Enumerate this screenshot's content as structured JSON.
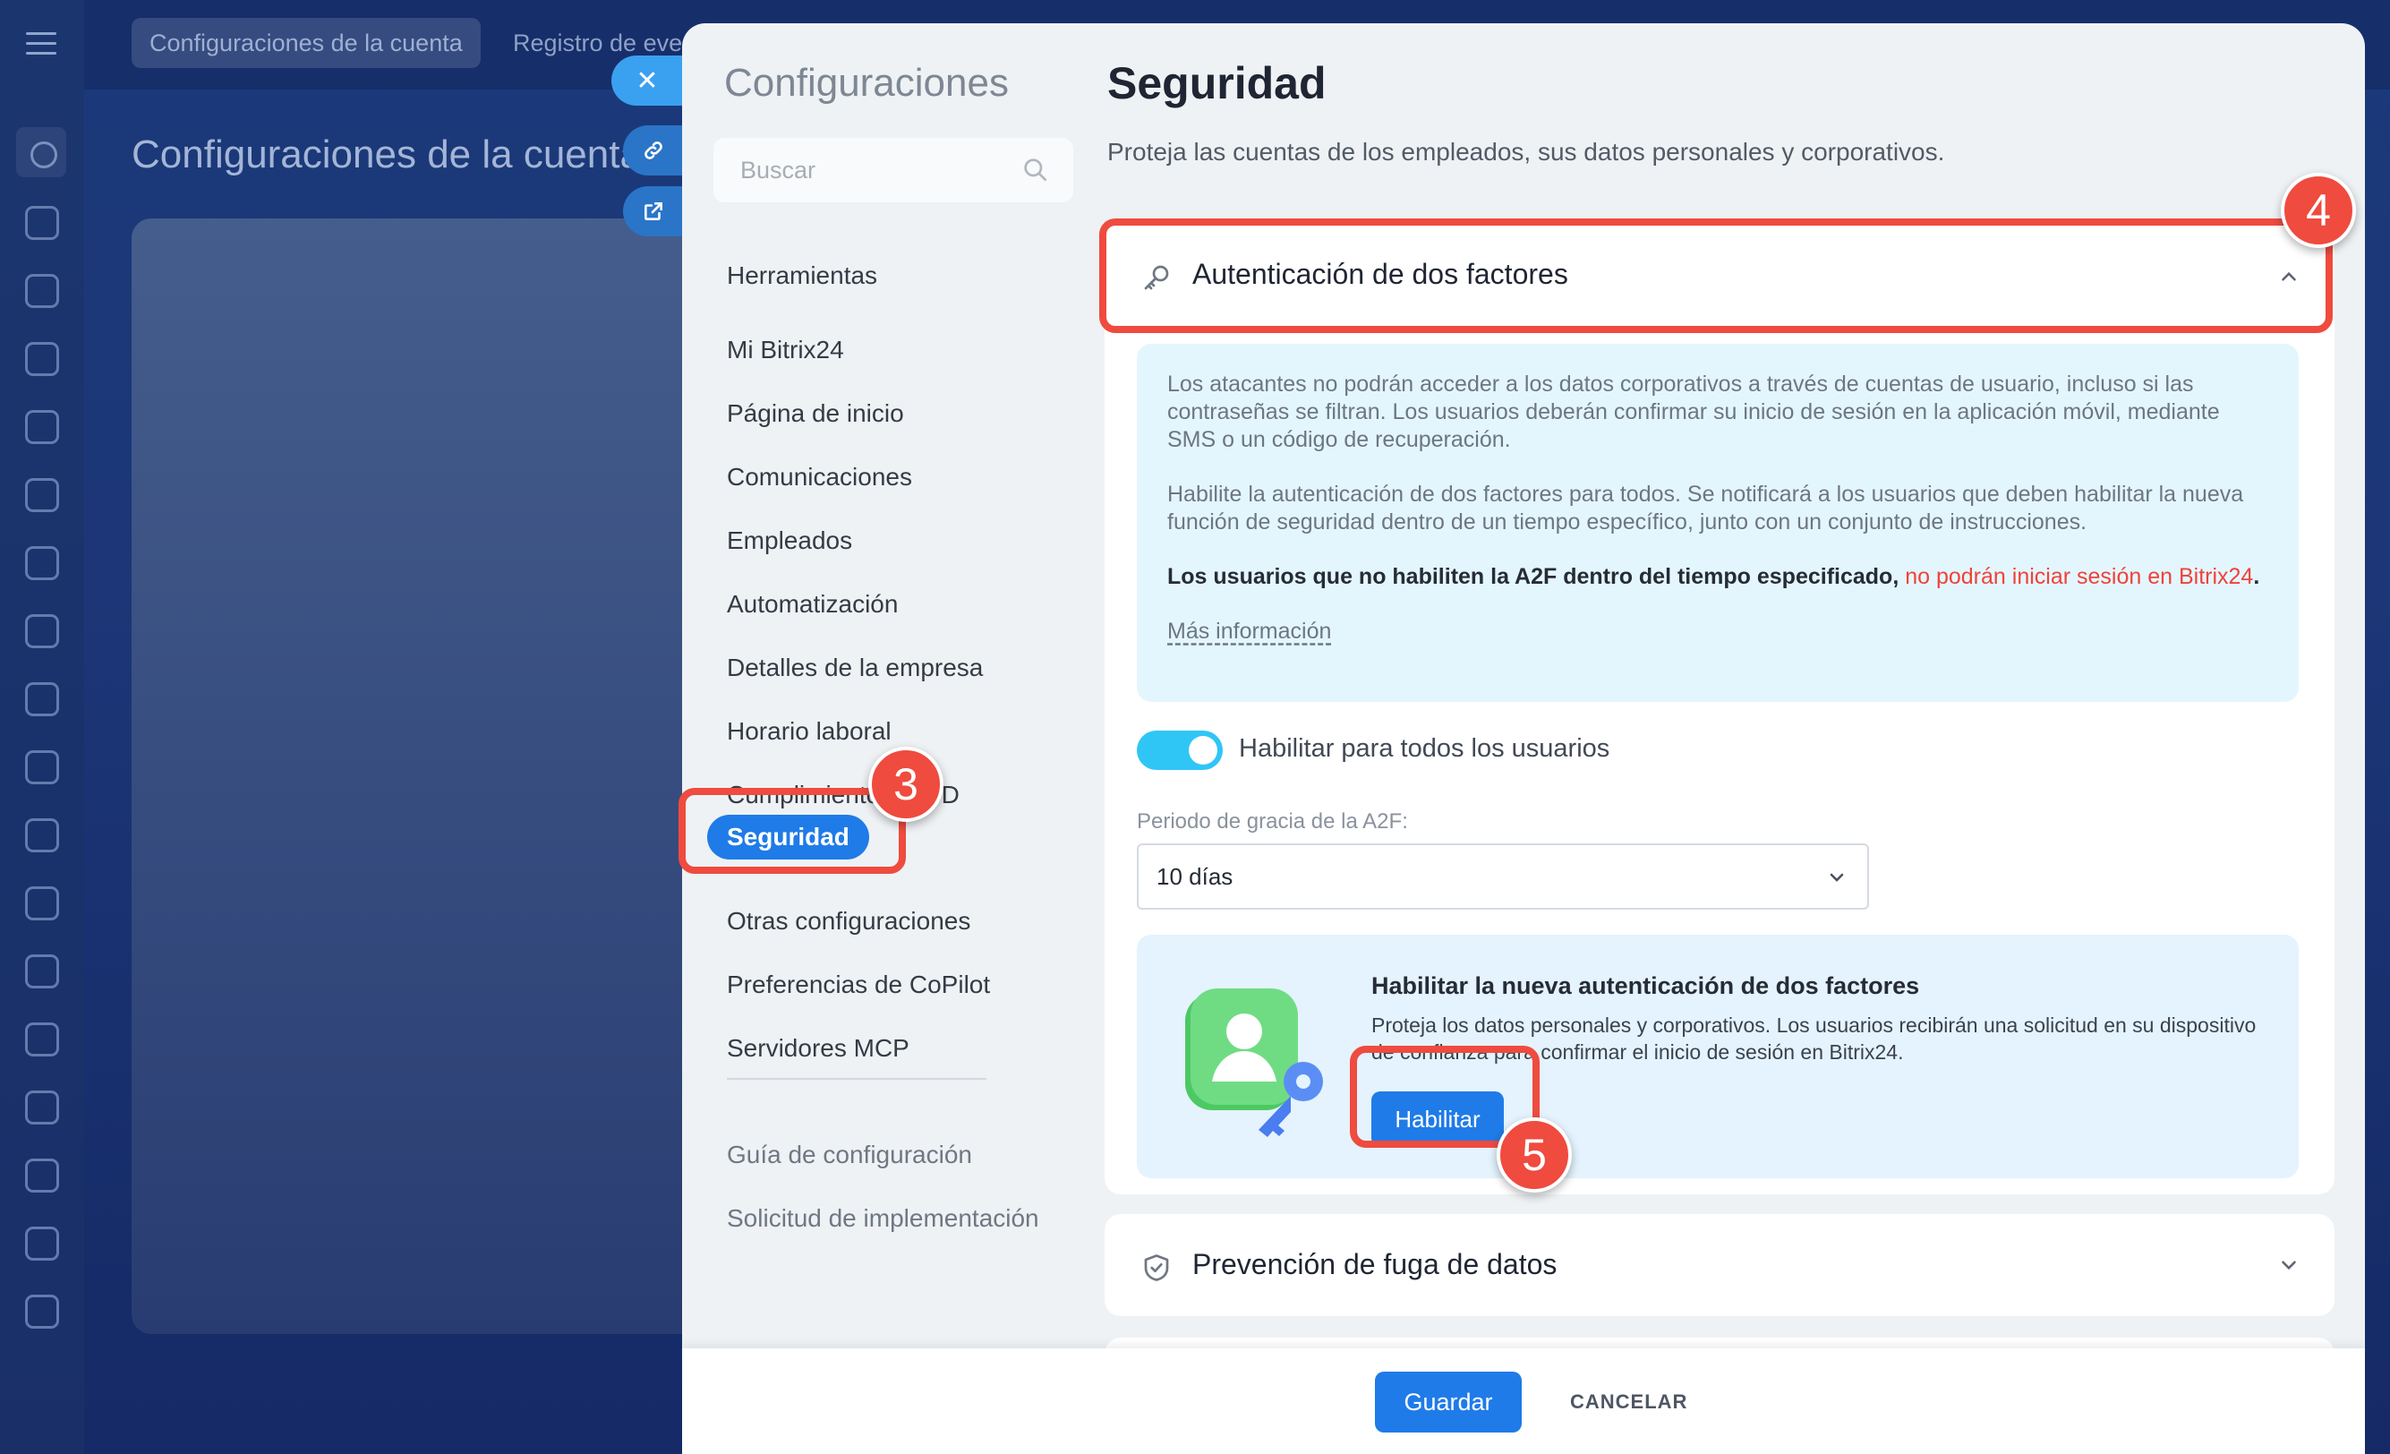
{
  "background": {
    "tabs": [
      "Configuraciones de la cuenta",
      "Registro de eve"
    ],
    "page_title": "Configuraciones de la cuenta"
  },
  "nav": {
    "title": "Configuraciones",
    "search_placeholder": "Buscar",
    "items": [
      "Herramientas",
      "Mi Bitrix24",
      "Página de inicio",
      "Comunicaciones",
      "Empleados",
      "Automatización",
      "Detalles de la empresa",
      "Horario laboral",
      "Cumplimiento RGPD",
      "Seguridad",
      "Otras configuraciones",
      "Preferencias de CoPilot",
      "Servidores MCP"
    ],
    "active_item": "Seguridad",
    "footer_items": [
      "Guía de configuración",
      "Solicitud de implementación"
    ]
  },
  "content": {
    "title": "Seguridad",
    "subtitle": "Proteja las cuentas de los empleados, sus datos personales y corporativos.",
    "two_factor": {
      "title": "Autenticación de dos factores",
      "info_1": "Los atacantes no podrán acceder a los datos corporativos a través de cuentas de usuario, incluso si las contraseñas se filtran. Los usuarios deberán confirmar su inicio de sesión en la aplicación móvil, mediante SMS o un código de recuperación.",
      "info_2": "Habilite la autenticación de dos factores para todos. Se notificará a los usuarios que deben habilitar la nueva función de seguridad dentro de un tiempo específico, junto con un conjunto de instrucciones.",
      "info_3_prefix": "Los usuarios que no habiliten la A2F dentro del tiempo especificado, ",
      "info_3_warning": "no podrán iniciar sesión en Bitrix24",
      "info_3_suffix": ".",
      "more_link": "Más información",
      "toggle_label": "Habilitar para todos los usuarios",
      "toggle_on": true,
      "grace_label": "Periodo de gracia de la A2F:",
      "grace_value": "10 días",
      "promo_title": "Habilitar la nueva autenticación de dos factores",
      "promo_text": "Proteja los datos personales y corporativos. Los usuarios recibirán una solicitud en su dispositivo de confianza para confirmar el inicio de sesión en Bitrix24.",
      "promo_button": "Habilitar"
    },
    "leak_prevention": {
      "title": "Prevención de fuga de datos"
    }
  },
  "footer": {
    "save": "Guardar",
    "cancel": "CANCELAR"
  },
  "annotations": {
    "step_3": "3",
    "step_4": "4",
    "step_5": "5"
  },
  "colors": {
    "accent": "#1f7be8",
    "annotation": "#ef4b3f",
    "toggle": "#2fc6f6",
    "warning_text": "#f0423a"
  }
}
